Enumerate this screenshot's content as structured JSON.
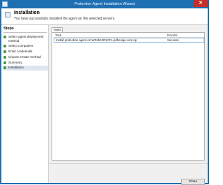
{
  "window": {
    "title": "Protection Agent Installation Wizard",
    "close_glyph": "✕"
  },
  "header": {
    "title": "Installation",
    "subtitle": "You have successfully installed the agent on the selected servers."
  },
  "steps": {
    "title": "Steps",
    "items": [
      {
        "label": "Select agent deployment method",
        "status": "complete"
      },
      {
        "label": "Select computers",
        "status": "complete"
      },
      {
        "label": "Enter credentials",
        "status": "complete"
      },
      {
        "label": "Choose restart method",
        "status": "complete"
      },
      {
        "label": "Summary",
        "status": "complete"
      },
      {
        "label": "Installation",
        "status": "current"
      }
    ]
  },
  "tabs": [
    {
      "label": "Tasks"
    }
  ],
  "tasks_table": {
    "columns": [
      "Task",
      "Results"
    ],
    "rows": [
      {
        "task": "Install protection agent on WS2k12R2ATA.pdhevaju.com.np",
        "result": "Success"
      }
    ]
  },
  "buttons": {
    "close": "Close"
  },
  "colors": {
    "titlebar": "#1f6fb3",
    "close": "#c7302a",
    "step_done": "#3a9a3a"
  }
}
